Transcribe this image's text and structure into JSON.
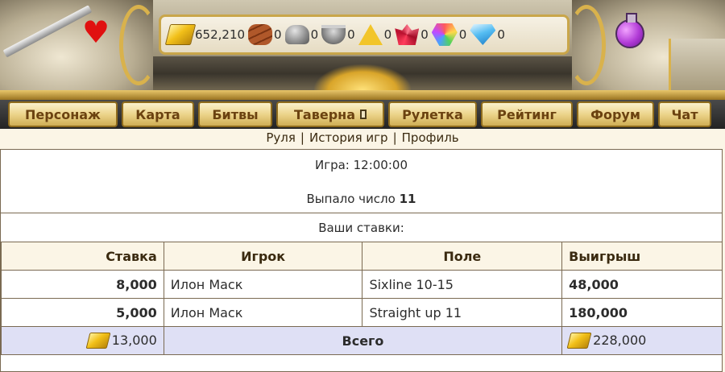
{
  "resources": {
    "gold": "652,210",
    "wood": "0",
    "stone": "0",
    "iron": "0",
    "sulfur": "0",
    "crystal": "0",
    "gems": "0",
    "diamond": "0"
  },
  "nav": {
    "items": [
      {
        "label": "Персонаж"
      },
      {
        "label": "Карта"
      },
      {
        "label": "Битвы"
      },
      {
        "label": "Таверна"
      },
      {
        "label": "Рулетка"
      },
      {
        "label": "Рейтинг"
      },
      {
        "label": "Форум"
      },
      {
        "label": "Чат"
      }
    ]
  },
  "sublinks": {
    "roulette": "Руля",
    "history": "История игр",
    "profile": "Профиль",
    "separator": "|"
  },
  "game": {
    "time_label": "Игра: 12:00:00",
    "drawn_label": "Выпало число",
    "drawn_number": "11",
    "stakes_title": "Ваши ставки:"
  },
  "bets_table": {
    "headers": {
      "stake": "Ставка",
      "player": "Игрок",
      "field": "Поле",
      "win": "Выигрыш"
    },
    "rows": [
      {
        "stake": "8,000",
        "player": "Илон Маск",
        "field": "Sixline 10-15",
        "win": "48,000"
      },
      {
        "stake": "5,000",
        "player": "Илон Маск",
        "field": "Straight up 11",
        "win": "180,000"
      }
    ],
    "total": {
      "stake": "13,000",
      "label": "Всего",
      "win": "228,000"
    }
  },
  "colors": {
    "nav_button": "#ecd48b",
    "nav_text": "#6b4210",
    "total_row": "#dfe0f5",
    "page_bg": "#fbf5e6"
  }
}
